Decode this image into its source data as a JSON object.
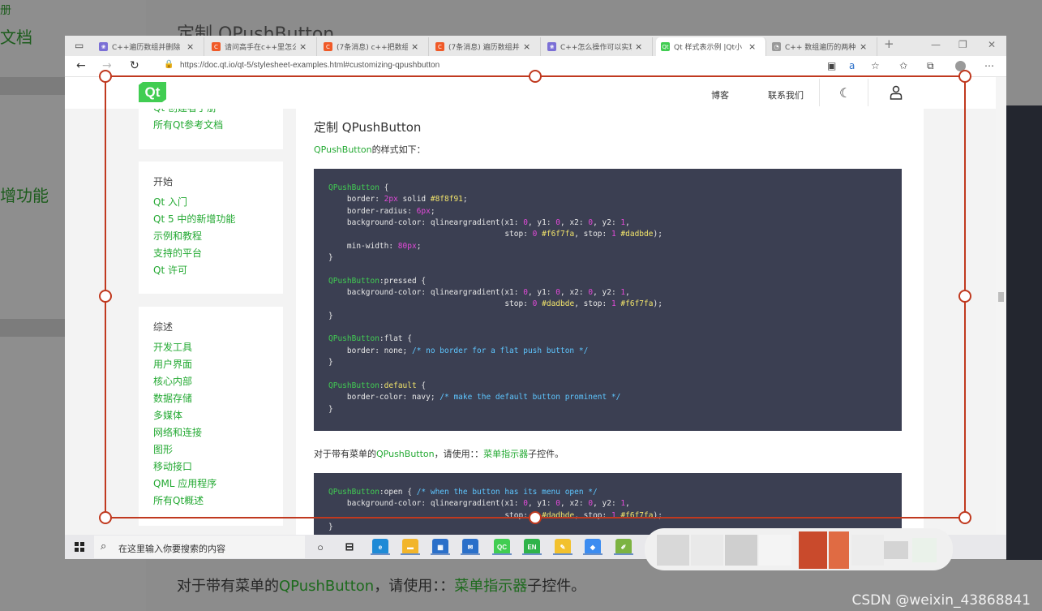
{
  "background_page": {
    "left_texts": [
      "册",
      "文档",
      "增功能"
    ],
    "title": "定制 QPushButton",
    "bottom_text_prefix": "对于带有菜单的",
    "bottom_text_link1": "QPushButton",
    "bottom_text_mid": "，请使用：：",
    "bottom_text_link2": "菜单指示器",
    "bottom_text_suffix": "子控件。",
    "watermark": "CSDN @weixin_43868841"
  },
  "browser": {
    "tabs": [
      {
        "title": "C++遍历数组并删除",
        "favicon_color": "#7b6fd6",
        "favicon": "❀"
      },
      {
        "title": "请问高手在c++里怎么",
        "favicon_color": "#f05a28",
        "favicon": "C"
      },
      {
        "title": "(7条消息) c++把数组",
        "favicon_color": "#f05a28",
        "favicon": "C"
      },
      {
        "title": "(7条消息) 遍历数组并",
        "favicon_color": "#f05a28",
        "favicon": "C"
      },
      {
        "title": "C++怎么操作可以实现",
        "favicon_color": "#7b6fd6",
        "favicon": "❀"
      },
      {
        "title": "Qt 样式表示例 |Qt小",
        "favicon_color": "#41cd52",
        "favicon": "Qt",
        "active": true
      },
      {
        "title": "C++ 数组遍历的两种",
        "favicon_color": "#999999",
        "favicon": "◔"
      }
    ],
    "new_tab_icon": "+",
    "url": "https://doc.qt.io/qt-5/stylesheet-examples.html#customizing-qpushbutton"
  },
  "site": {
    "logo": "Qt",
    "nav_blog": "博客",
    "nav_contact": "联系我们"
  },
  "sidebar": {
    "top_links": [
      "Qt 创建者手册",
      "所有Qt参考文档"
    ],
    "start": {
      "heading": "开始",
      "links": [
        "Qt 入门",
        "Qt 5 中的新增功能",
        "示例和教程",
        "支持的平台",
        "Qt 许可"
      ]
    },
    "overview": {
      "heading": "综述",
      "links": [
        "开发工具",
        "用户界面",
        "核心内部",
        "数据存储",
        "多媒体",
        "网络和连接",
        "图形",
        "移动接口",
        "QML 应用程序",
        "所有Qt概述"
      ]
    }
  },
  "main": {
    "heading": "定制 QPushButton",
    "intro_link": "QPushButton",
    "intro_text": "的样式如下：",
    "menu_prefix": "对于带有菜单的",
    "menu_link1": "QPushButton",
    "menu_mid": "，请使用：：",
    "menu_link2": "菜单指示器",
    "menu_suffix": "子控件。"
  },
  "taskbar": {
    "search_placeholder": "在这里输入你要搜索的内容",
    "apps": [
      {
        "name": "cortana",
        "label": "○",
        "color": "transparent"
      },
      {
        "name": "task-view",
        "label": "⊟",
        "color": "transparent"
      },
      {
        "name": "edge",
        "label": "e",
        "color": "#1e8ad6"
      },
      {
        "name": "file-explorer",
        "label": "▬",
        "color": "#f2b52b"
      },
      {
        "name": "store",
        "label": "▦",
        "color": "#2a6fc9"
      },
      {
        "name": "mail",
        "label": "✉",
        "color": "#2a6fc9"
      },
      {
        "name": "qt-creator",
        "label": "QC",
        "color": "#41cd52"
      },
      {
        "name": "qt-app",
        "label": "EN",
        "color": "#2fb34a"
      },
      {
        "name": "notes",
        "label": "✎",
        "color": "#f2c12e"
      },
      {
        "name": "feishu",
        "label": "◆",
        "color": "#3c8cf0"
      },
      {
        "name": "paint",
        "label": "✐",
        "color": "#7cb342"
      }
    ]
  }
}
